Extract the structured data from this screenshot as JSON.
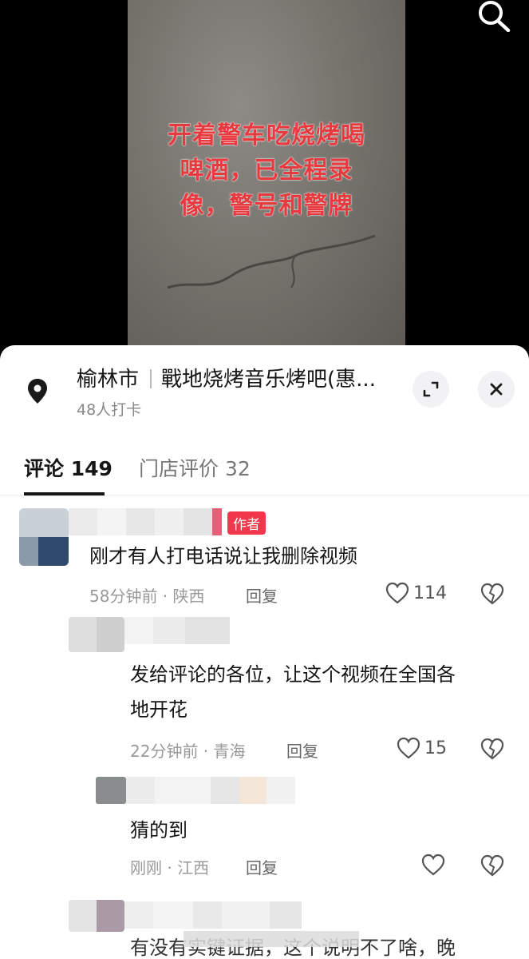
{
  "video": {
    "overlay_lines": [
      "开着警车吃烧烤喝",
      "啤酒，已全程录",
      "像，警号和警牌"
    ]
  },
  "location": {
    "city": "榆林市",
    "place": "戰地烧烤音乐烤吧(惠...",
    "checkins": "48人打卡"
  },
  "tabs": [
    {
      "label": "评论 149"
    },
    {
      "label": "门店评价 32"
    }
  ],
  "comments": [
    {
      "text": "刚才有人打电话说让我删除视频",
      "time": "58分钟前",
      "region": "陕西",
      "reply": "回复",
      "likes": "114",
      "badge": "作者"
    },
    {
      "text_lines": [
        "发给评论的各位，让这个视频在全国各",
        "地开花"
      ],
      "time": "22分钟前",
      "region": "青海",
      "reply": "回复",
      "likes": "15"
    },
    {
      "text": "猜的到",
      "time": "刚刚",
      "region": "江西",
      "reply": "回复",
      "likes": ""
    },
    {
      "text": "有没有实键证据，这个说明不了啥，晚"
    }
  ],
  "separator": " · ",
  "colors": {
    "accent_red": "#f0374b",
    "overlay_red": "#e8393f"
  },
  "icons": [
    "search-icon",
    "location-pin-icon",
    "expand-icon",
    "close-icon",
    "heart-icon",
    "broken-heart-icon"
  ]
}
